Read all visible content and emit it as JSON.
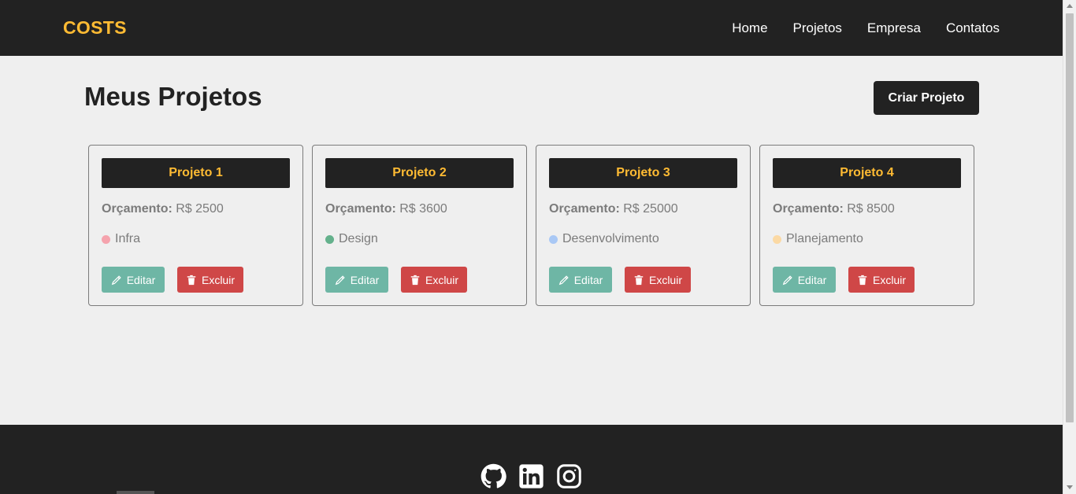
{
  "navbar": {
    "logo": "COSTS",
    "links": [
      "Home",
      "Projetos",
      "Empresa",
      "Contatos"
    ]
  },
  "main": {
    "title": "Meus Projetos",
    "create_button": "Criar Projeto"
  },
  "projects": [
    {
      "name": "Projeto 1",
      "budget_label": "Orçamento:",
      "budget_value": "R$ 2500",
      "category": "Infra",
      "category_color": "#f5a3ad"
    },
    {
      "name": "Projeto 2",
      "budget_label": "Orçamento:",
      "budget_value": "R$ 3600",
      "category": "Design",
      "category_color": "#64b18c"
    },
    {
      "name": "Projeto 3",
      "budget_label": "Orçamento:",
      "budget_value": "R$ 25000",
      "category": "Desenvolvimento",
      "category_color": "#a9c8f5"
    },
    {
      "name": "Projeto 4",
      "budget_label": "Orçamento:",
      "budget_value": "R$ 8500",
      "category": "Planejamento",
      "category_color": "#fbd9a4"
    }
  ],
  "card_actions": {
    "edit_label": "Editar",
    "delete_label": "Excluir",
    "edit_icon": "pencil-icon",
    "delete_icon": "trash-icon"
  },
  "footer": {
    "social_icons": [
      "github-icon",
      "linkedin-icon",
      "instagram-icon"
    ]
  },
  "colors": {
    "accent": "#ffbb33",
    "dark": "#222222",
    "edit": "#6eb6a5",
    "delete": "#cf4747"
  }
}
